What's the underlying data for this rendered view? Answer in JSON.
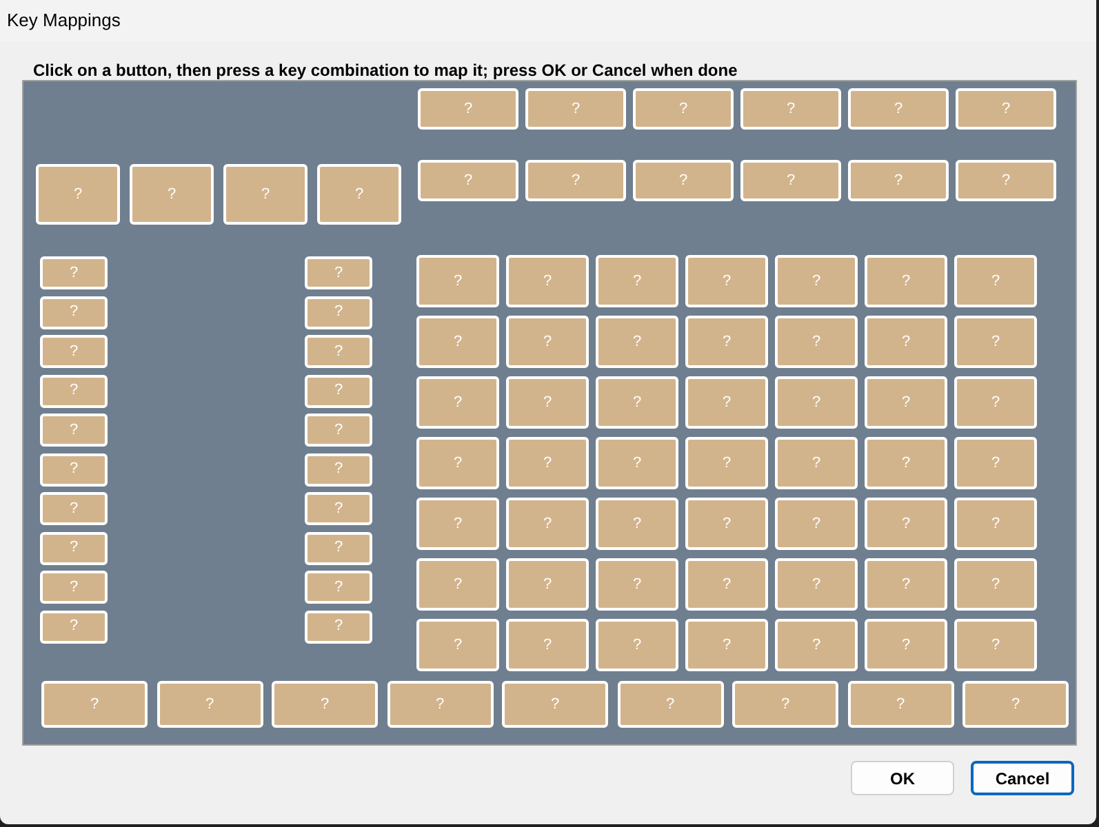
{
  "window": {
    "title": "Key Mappings"
  },
  "instruction": "Click on a button, then press a key combination to map it; press OK or Cancel when done",
  "top_rows": [
    [
      "?",
      "?",
      "?",
      "?",
      "?",
      "?"
    ],
    [
      "?",
      "?",
      "?",
      "?",
      "?",
      "?"
    ]
  ],
  "left_keys": [
    "?",
    "?",
    "?",
    "?"
  ],
  "left_column": [
    "?",
    "?",
    "?",
    "?",
    "?",
    "?",
    "?",
    "?",
    "?",
    "?"
  ],
  "right_column": [
    "?",
    "?",
    "?",
    "?",
    "?",
    "?",
    "?",
    "?",
    "?",
    "?"
  ],
  "key_grid": [
    [
      "?",
      "?",
      "?",
      "?",
      "?",
      "?",
      "?"
    ],
    [
      "?",
      "?",
      "?",
      "?",
      "?",
      "?",
      "?"
    ],
    [
      "?",
      "?",
      "?",
      "?",
      "?",
      "?",
      "?"
    ],
    [
      "?",
      "?",
      "?",
      "?",
      "?",
      "?",
      "?"
    ],
    [
      "?",
      "?",
      "?",
      "?",
      "?",
      "?",
      "?"
    ],
    [
      "?",
      "?",
      "?",
      "?",
      "?",
      "?",
      "?"
    ],
    [
      "?",
      "?",
      "?",
      "?",
      "?",
      "?",
      "?"
    ]
  ],
  "bottom_row": [
    "?",
    "?",
    "?",
    "?",
    "?",
    "?",
    "?",
    "?",
    "?"
  ],
  "buttons": [
    {
      "label": "OK",
      "focused": false
    },
    {
      "label": "Cancel",
      "focused": true
    }
  ]
}
